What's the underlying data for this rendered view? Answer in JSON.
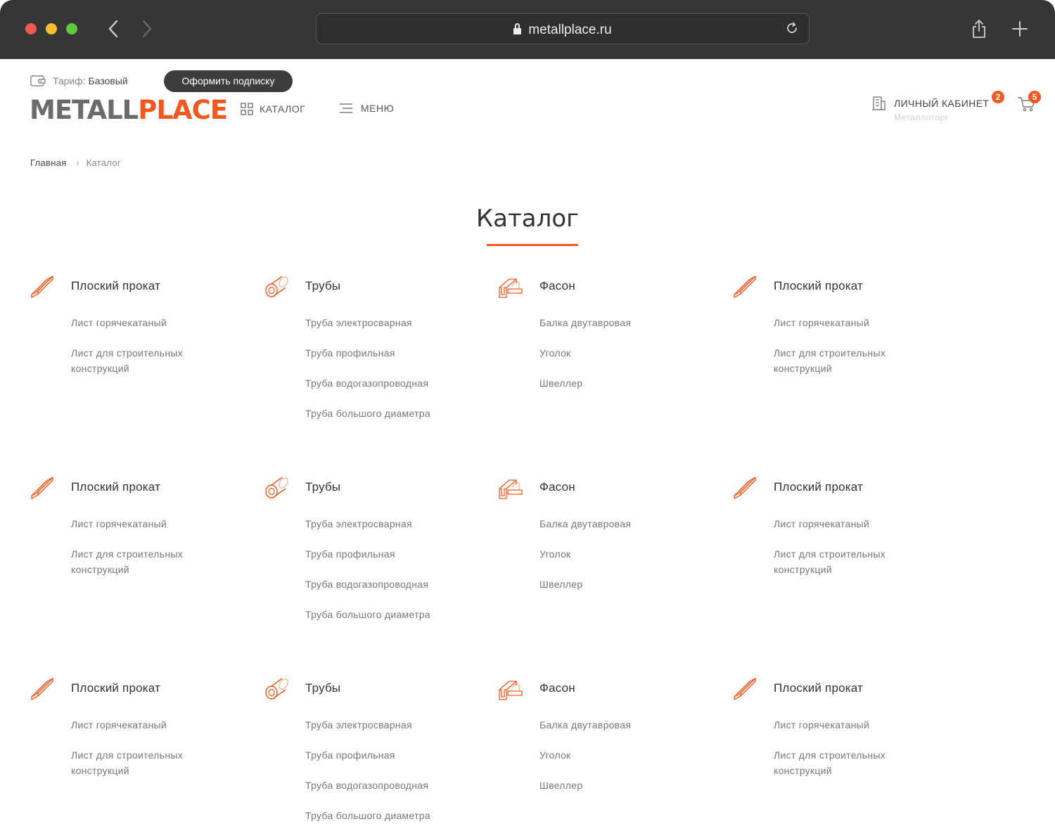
{
  "browser": {
    "url": "metallplace.ru"
  },
  "header": {
    "tariff_label": "Тариф:",
    "tariff_value": "Базовый",
    "subscribe_label": "Оформить подписку",
    "logo_part1": "METALL",
    "logo_part2": "PLACE",
    "catalog_label": "КАТАЛОГ",
    "menu_label": "МЕНЮ",
    "cabinet_label": "ЛИЧНЫЙ КАБИНЕТ",
    "cabinet_sub": "Металлоторг",
    "cabinet_badge": "2",
    "cart_badge": "5"
  },
  "breadcrumb": {
    "home": "Главная",
    "separator": "›",
    "current": "Каталог"
  },
  "page_title": "Каталог",
  "colors": {
    "accent": "#f05a22",
    "dark": "#3d3d3d"
  },
  "catalog": {
    "rows": [
      {
        "columns": [
          {
            "icon": "flat-sheet-icon",
            "title": "Плоский прокат",
            "items": [
              "Лист горячекатаный",
              "Лист для строительных конструкций"
            ]
          },
          {
            "icon": "pipe-icon",
            "title": "Трубы",
            "items": [
              "Труба электросварная",
              "Труба профильная",
              "Труба водогазопроводная",
              "Труба большого диаметра"
            ]
          },
          {
            "icon": "beam-icon",
            "title": "Фасон",
            "items": [
              "Балка двутавровая",
              "Уголок",
              "Швеллер"
            ]
          },
          {
            "icon": "flat-sheet-icon",
            "title": "Плоский прокат",
            "items": [
              "Лист горячекатаный",
              "Лист для строительных конструкций"
            ]
          }
        ]
      },
      {
        "columns": [
          {
            "icon": "flat-sheet-icon",
            "title": "Плоский прокат",
            "items": [
              "Лист горячекатаный",
              "Лист для строительных конструкций"
            ]
          },
          {
            "icon": "pipe-icon",
            "title": "Трубы",
            "items": [
              "Труба электросварная",
              "Труба профильная",
              "Труба водогазопроводная",
              "Труба большого диаметра"
            ]
          },
          {
            "icon": "beam-icon",
            "title": "Фасон",
            "items": [
              "Балка двутавровая",
              "Уголок",
              "Швеллер"
            ]
          },
          {
            "icon": "flat-sheet-icon",
            "title": "Плоский прокат",
            "items": [
              "Лист горячекатаный",
              "Лист для строительных конструкций"
            ]
          }
        ]
      },
      {
        "columns": [
          {
            "icon": "flat-sheet-icon",
            "title": "Плоский прокат",
            "items": [
              "Лист горячекатаный",
              "Лист для строительных конструкций"
            ]
          },
          {
            "icon": "pipe-icon",
            "title": "Трубы",
            "items": [
              "Труба электросварная",
              "Труба профильная",
              "Труба водогазопроводная",
              "Труба большого диаметра"
            ]
          },
          {
            "icon": "beam-icon",
            "title": "Фасон",
            "items": [
              "Балка двутавровая",
              "Уголок",
              "Швеллер"
            ]
          },
          {
            "icon": "flat-sheet-icon",
            "title": "Плоский прокат",
            "items": [
              "Лист горячекатаный",
              "Лист для строительных конструкций"
            ]
          }
        ]
      }
    ]
  }
}
